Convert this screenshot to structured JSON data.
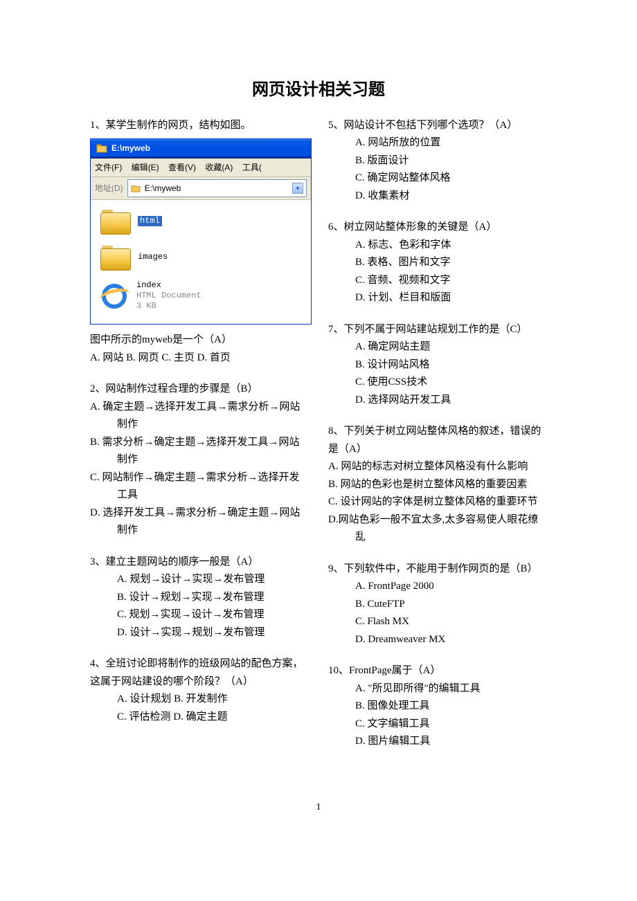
{
  "title": "网页设计相关习题",
  "page_number": "1",
  "xp": {
    "title": "E:\\myweb",
    "menus": [
      "文件(F)",
      "编辑(E)",
      "查看(V)",
      "收藏(A)",
      "工具("
    ],
    "address_label": "地址(D)",
    "address_value": "E:\\myweb",
    "items": [
      {
        "type": "folder",
        "name": "html",
        "selected": true
      },
      {
        "type": "folder",
        "name": "images",
        "selected": false
      },
      {
        "type": "ie",
        "name": "index",
        "sub1": "HTML Document",
        "sub2": "3 KB"
      }
    ]
  },
  "left": {
    "q1": {
      "prompt": "1、某学生制作的网页，结构如图。",
      "after_img": "图中所示的myweb是一个（A）",
      "opts_inline": "A. 网站 B. 网页 C. 主页  D. 首页"
    },
    "q2": {
      "prompt": "2、网站制作过程合理的步骤是（B）",
      "opts": [
        "A. 确定主题→选择开发工具→需求分析→网站制作",
        "B. 需求分析→确定主题→选择开发工具→网站制作",
        "C. 网站制作→确定主题→需求分析→选择开发工具",
        "D. 选择开发工具→需求分析→确定主题→网站制作"
      ]
    },
    "q3": {
      "prompt": "3、建立主题网站的顺序一般是（A）",
      "opts": [
        "A. 规划→设计→实现→发布管理",
        "B. 设计→规划→实现→发布管理",
        "C. 规划→实现→设计→发布管理",
        "D. 设计→实现→规划→发布管理"
      ]
    },
    "q4": {
      "prompt": "4、全班讨论即将制作的班级网站的配色方案，这属于网站建设的哪个阶段？（A）",
      "opts": [
        "A. 设计规划  B. 开发制作",
        "C. 评估检测  D. 确定主题"
      ]
    }
  },
  "right": {
    "q5": {
      "prompt": "5、网站设计不包括下列哪个选项？（A）",
      "opts": [
        "A. 网站所放的位置",
        "B. 版面设计",
        "C. 确定网站整体风格",
        "D. 收集素材"
      ]
    },
    "q6": {
      "prompt": "6、树立网站整体形象的关键是（A）",
      "opts": [
        "A. 标志、色彩和字体",
        "B. 表格、图片和文字",
        "C. 音频、视频和文字",
        "D. 计划、栏目和版面"
      ]
    },
    "q7": {
      "prompt": "7、下列不属于网站建站规划工作的是（C）",
      "opts": [
        "A. 确定网站主题",
        "B. 设计网站风格",
        "C. 使用CSS技术",
        "D. 选择网站开发工具"
      ]
    },
    "q8": {
      "prompt": "8、下列关于树立网站整体风格的叙述，错误的是（A）",
      "opts": [
        "A. 网站的标志对树立整体风格没有什么影响",
        "B. 网站的色彩也是树立整体风格的重要因素",
        "C. 设计网站的字体是树立整体风格的重要环节",
        "D.网站色彩一般不宜太多,太多容易使人眼花缭乱"
      ]
    },
    "q9": {
      "prompt": "9、下列软件中，不能用于制作网页的是（B）",
      "opts": [
        "A. FrontPage 2000",
        "B. CuteFTP",
        "C. Flash MX",
        "D. Dreamweaver MX"
      ]
    },
    "q10": {
      "prompt": "10、FrontPage属于（A）",
      "opts": [
        "A. \"所见即所得\"的编辑工具",
        "B. 图像处理工具",
        "C. 文字编辑工具",
        "D. 图片编辑工具"
      ]
    }
  }
}
